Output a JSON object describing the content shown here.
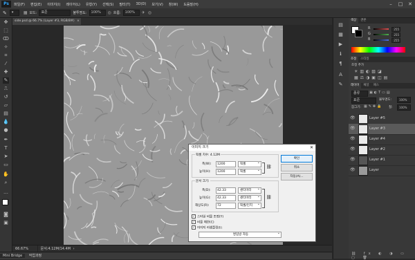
{
  "app": {
    "logo": "Ps"
  },
  "menus": [
    "파일(F)",
    "편집(E)",
    "이미지(I)",
    "레이어(L)",
    "유형(Y)",
    "선택(S)",
    "필터(T)",
    "3D(D)",
    "보기(V)",
    "창(W)",
    "도움말(H)"
  ],
  "window_controls": [
    "–",
    "□",
    "✕"
  ],
  "options": {
    "mode_label": "모드:",
    "mode_value": "표준",
    "opacity_label": "불투명도:",
    "opacity_value": "100%",
    "flow_label": "흐름:",
    "flow_value": "100%"
  },
  "document": {
    "tab_title": "side.psd @ 66.7% (Layer #3, RGB/8#)",
    "zoom": "66.67%",
    "doc_size": "문서:4.12M/14.4M"
  },
  "bottom_tabs": [
    "Mini Bridge",
    "작업과정"
  ],
  "panels": {
    "color_tabs": [
      "색상",
      "견본"
    ],
    "color_sliders": [
      {
        "label": "R",
        "value": "255",
        "color": "#e05050"
      },
      {
        "label": "G",
        "value": "255",
        "color": "#50b050"
      },
      {
        "label": "B",
        "value": "255",
        "color": "#5070e0"
      }
    ],
    "adjust_tabs": [
      "조정",
      "스타일"
    ],
    "adjust_label": "조정 추가",
    "layers_tabs": [
      "레이어",
      "채널",
      "패스"
    ],
    "layers_kind": "종류",
    "blend_mode": "표준",
    "opacity_label": "불투명도:",
    "opacity_value": "100%",
    "lock_label": "잠그기:",
    "fill_label": "칠:",
    "fill_value": "100%",
    "layers": [
      {
        "name": "Layer #5",
        "selected": false,
        "thumb": "#eaeaea"
      },
      {
        "name": "Layer #3",
        "selected": true,
        "thumb": "#eaeaea"
      },
      {
        "name": "Layer #4",
        "selected": false,
        "thumb": "#eaeaea"
      },
      {
        "name": "Layer #2",
        "selected": false,
        "thumb": "#eaeaea"
      },
      {
        "name": "Layer #1",
        "selected": false,
        "thumb": "#555555"
      },
      {
        "name": "Layer",
        "selected": false,
        "thumb": "#9a9a9a"
      }
    ]
  },
  "dialog": {
    "title": "이미지 크기",
    "pixel_dim_label": "픽셀 치수: 4.12M",
    "width_label": "폭(W):",
    "width_value": "1200",
    "width_unit": "픽셀",
    "height_label": "높이(H):",
    "height_value": "1200",
    "height_unit": "픽셀",
    "doc_size_label": "문서 크기:",
    "doc_width_label": "폭(D):",
    "doc_width_value": "42.33",
    "doc_width_unit": "센티미터",
    "doc_height_label": "높이(G):",
    "doc_height_value": "42.33",
    "doc_height_unit": "센티미터",
    "resolution_label": "해상도(R):",
    "resolution_value": "72",
    "resolution_unit": "픽셀/인치",
    "chk_scale_styles": "스타일 비율 조정(Y)",
    "chk_constrain": "비율 제한(C)",
    "chk_resample": "이미지 리샘플링(I):",
    "resample_method": "쌍입방 자동",
    "btn_ok": "확인",
    "btn_cancel": "취소",
    "btn_auto": "자동(A)..."
  }
}
